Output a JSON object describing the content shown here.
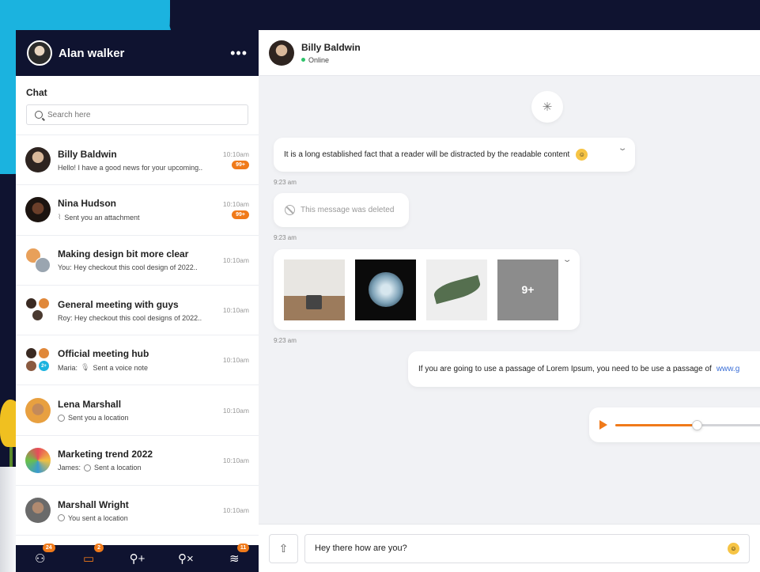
{
  "user": {
    "name": "Alan walker"
  },
  "sidebar": {
    "section_title": "Chat",
    "search_placeholder": "Search here",
    "chats": [
      {
        "name": "Billy Baldwin",
        "msg": "Hello! I have a good news for your upcoming..",
        "time": "10:10am",
        "badge": "99+"
      },
      {
        "name": "Nina Hudson",
        "msg": "Sent you an attachment",
        "time": "10:10am",
        "badge": "99+"
      },
      {
        "name": "Making design bit more clear",
        "msg": "You: Hey checkout this cool design of 2022..",
        "time": "10:10am",
        "badge": ""
      },
      {
        "name": "General meeting with guys",
        "msg": "Roy: Hey checkout this cool designs of 2022..",
        "time": "10:10am",
        "badge": ""
      },
      {
        "name": "Official meeting hub",
        "sender": "Maria:",
        "msg": "Sent a voice note",
        "time": "10:10am",
        "badge": "",
        "extra": "2+"
      },
      {
        "name": "Lena Marshall",
        "msg": "Sent you a location",
        "time": "10:10am",
        "badge": ""
      },
      {
        "name": "Marketing trend 2022",
        "sender": "James:",
        "msg": "Sent a location",
        "time": "10:10am",
        "badge": ""
      },
      {
        "name": "Marshall Wright",
        "msg": "You sent a location",
        "time": "10:10am",
        "badge": ""
      }
    ]
  },
  "nav": {
    "contacts_badge": "24",
    "chats_badge": "2",
    "layers_badge": "11"
  },
  "contact": {
    "name": "Billy Baldwin",
    "status": "Online"
  },
  "messages": {
    "text1": "It is a long established fact that a reader will be distracted by the readable content",
    "time1": "9:23 am",
    "deleted": "This message was deleted",
    "time2": "9:23 am",
    "more_count": "9+",
    "time3": "9:23 am",
    "text2": "If you are going to use a passage of Lorem Ipsum, you need to be use a passage of",
    "link": "www.g",
    "voice_progress": 0.54
  },
  "composer": {
    "value": "Hey there how are you?"
  },
  "colors": {
    "accent": "#f07a1a",
    "navy": "#0f1330",
    "online": "#2ec36a"
  }
}
